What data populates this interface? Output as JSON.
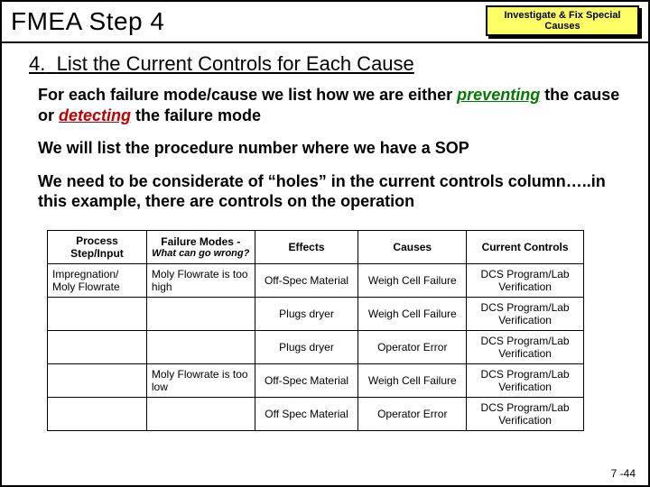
{
  "header": {
    "title": "FMEA Step 4",
    "badge_line1": "Investigate & Fix Special",
    "badge_line2": "Causes"
  },
  "section": {
    "number": "4.",
    "heading": "List the Current Controls for Each Cause"
  },
  "body": {
    "p1_a": "For each failure mode/cause we list how we are either ",
    "p1_kw1": "preventing",
    "p1_b": " the cause or ",
    "p1_kw2": "detecting",
    "p1_c": " the failure mode",
    "p2": "We will list the procedure number where we have a SOP",
    "p3": "We need to be considerate of “holes” in the current controls column…..in this example, there are controls on the operation"
  },
  "table": {
    "headers": {
      "c1": "Process Step/Input",
      "c2a": "Failure Modes -",
      "c2b": "What can go wrong?",
      "c3": "Effects",
      "c4": "Causes",
      "c5": "Current Controls"
    },
    "rows": [
      {
        "c1": "Impregnation/ Moly Flowrate",
        "c2": "Moly Flowrate is too high",
        "c3": "Off-Spec Material",
        "c4": "Weigh Cell Failure",
        "c5": "DCS Program/Lab Verification"
      },
      {
        "c1": "",
        "c2": "",
        "c3": "Plugs dryer",
        "c4": "Weigh Cell Failure",
        "c5": "DCS Program/Lab Verification"
      },
      {
        "c1": "",
        "c2": "",
        "c3": "Plugs dryer",
        "c4": "Operator Error",
        "c5": "DCS Program/Lab Verification"
      },
      {
        "c1": "",
        "c2": "Moly Flowrate is too low",
        "c3": "Off-Spec Material",
        "c4": "Weigh Cell Failure",
        "c5": "DCS Program/Lab Verification"
      },
      {
        "c1": "",
        "c2": "",
        "c3": "Off Spec Material",
        "c4": "Operator Error",
        "c5": "DCS Program/Lab Verification"
      }
    ]
  },
  "slide_number": "7 -44",
  "chart_data": {
    "type": "table",
    "title": "FMEA Current Controls",
    "columns": [
      "Process Step/Input",
      "Failure Modes - What can go wrong?",
      "Effects",
      "Causes",
      "Current Controls"
    ],
    "rows": [
      [
        "Impregnation/ Moly Flowrate",
        "Moly Flowrate is too high",
        "Off-Spec Material",
        "Weigh Cell Failure",
        "DCS Program/Lab Verification"
      ],
      [
        "",
        "",
        "Plugs dryer",
        "Weigh Cell Failure",
        "DCS Program/Lab Verification"
      ],
      [
        "",
        "",
        "Plugs dryer",
        "Operator Error",
        "DCS Program/Lab Verification"
      ],
      [
        "",
        "Moly Flowrate is too low",
        "Off-Spec Material",
        "Weigh Cell Failure",
        "DCS Program/Lab Verification"
      ],
      [
        "",
        "",
        "Off Spec Material",
        "Operator Error",
        "DCS Program/Lab Verification"
      ]
    ]
  }
}
